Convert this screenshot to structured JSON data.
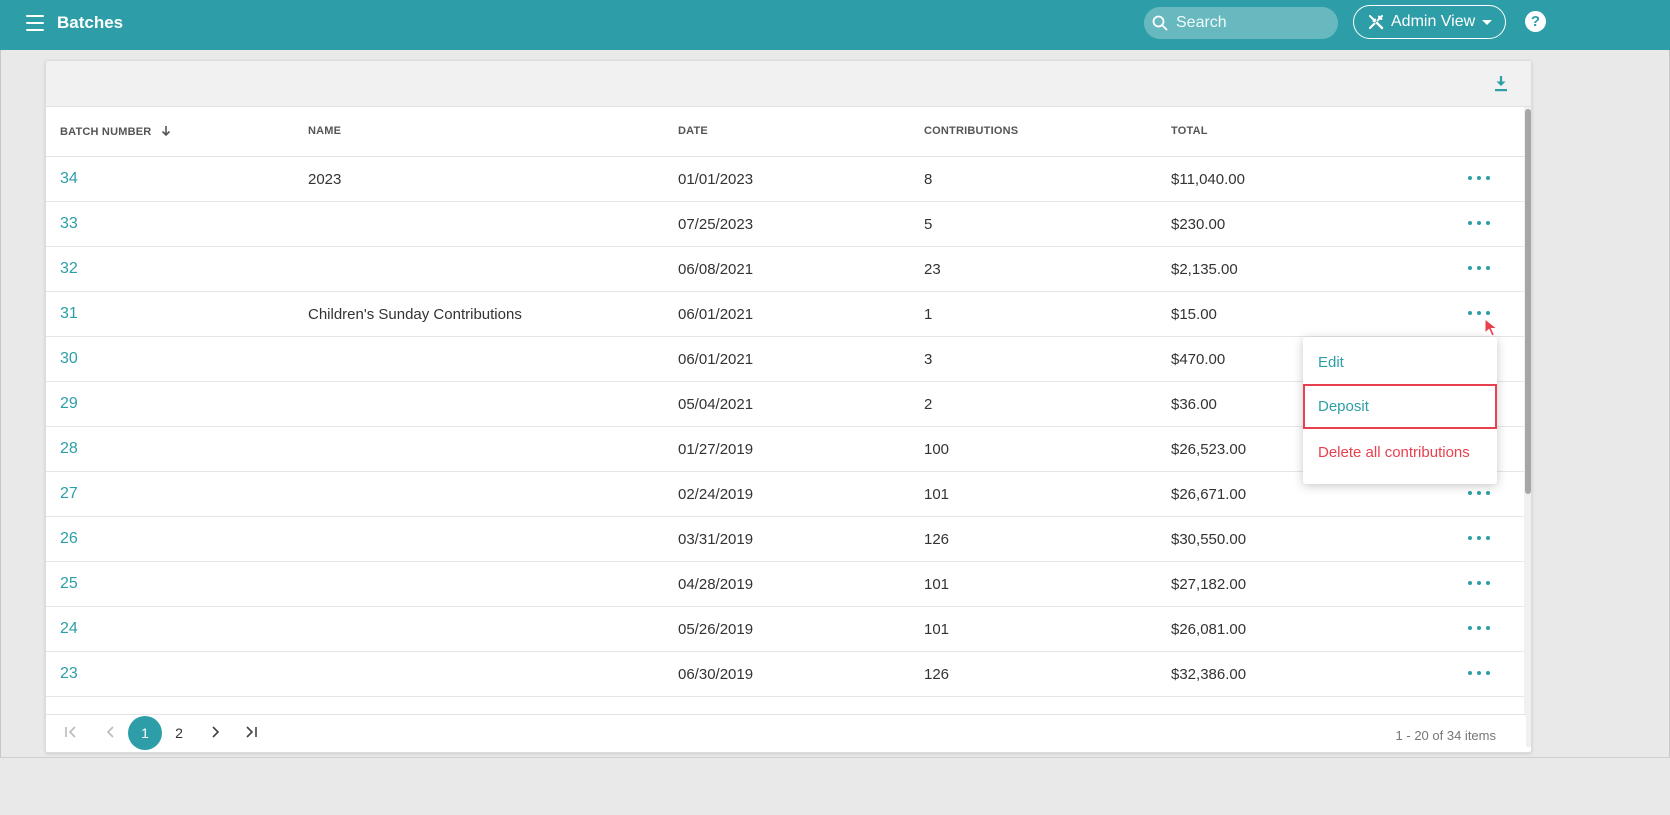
{
  "header": {
    "title": "Batches",
    "search_placeholder": "Search",
    "admin_view_label": "Admin View",
    "help_label": "?"
  },
  "table": {
    "columns": {
      "batch_number": "BATCH NUMBER",
      "name": "NAME",
      "date": "DATE",
      "contributions": "CONTRIBUTIONS",
      "total": "TOTAL"
    },
    "rows": [
      {
        "batch": "34",
        "name": "2023",
        "date": "01/01/2023",
        "contributions": "8",
        "total": "$11,040.00"
      },
      {
        "batch": "33",
        "name": "",
        "date": "07/25/2023",
        "contributions": "5",
        "total": "$230.00"
      },
      {
        "batch": "32",
        "name": "",
        "date": "06/08/2021",
        "contributions": "23",
        "total": "$2,135.00"
      },
      {
        "batch": "31",
        "name": "Children's Sunday Contributions",
        "date": "06/01/2021",
        "contributions": "1",
        "total": "$15.00"
      },
      {
        "batch": "30",
        "name": "",
        "date": "06/01/2021",
        "contributions": "3",
        "total": "$470.00"
      },
      {
        "batch": "29",
        "name": "",
        "date": "05/04/2021",
        "contributions": "2",
        "total": "$36.00"
      },
      {
        "batch": "28",
        "name": "",
        "date": "01/27/2019",
        "contributions": "100",
        "total": "$26,523.00"
      },
      {
        "batch": "27",
        "name": "",
        "date": "02/24/2019",
        "contributions": "101",
        "total": "$26,671.00"
      },
      {
        "batch": "26",
        "name": "",
        "date": "03/31/2019",
        "contributions": "126",
        "total": "$30,550.00"
      },
      {
        "batch": "25",
        "name": "",
        "date": "04/28/2019",
        "contributions": "101",
        "total": "$27,182.00"
      },
      {
        "batch": "24",
        "name": "",
        "date": "05/26/2019",
        "contributions": "101",
        "total": "$26,081.00"
      },
      {
        "batch": "23",
        "name": "",
        "date": "06/30/2019",
        "contributions": "126",
        "total": "$32,386.00"
      }
    ]
  },
  "row_menu": {
    "edit": "Edit",
    "deposit": "Deposit",
    "delete_all": "Delete all contributions"
  },
  "pagination": {
    "pages": [
      "1",
      "2"
    ],
    "current_page": "1",
    "info": "1 - 20 of 34 items"
  },
  "colors": {
    "primary": "#2d9ea7",
    "danger": "#e8404f"
  },
  "icons": {
    "menu": "hamburger-icon",
    "search": "search-icon",
    "admin": "tools-icon",
    "help": "help-icon",
    "download": "download-icon",
    "sort": "arrow-down-icon",
    "row_actions": "ellipsis-icon"
  }
}
